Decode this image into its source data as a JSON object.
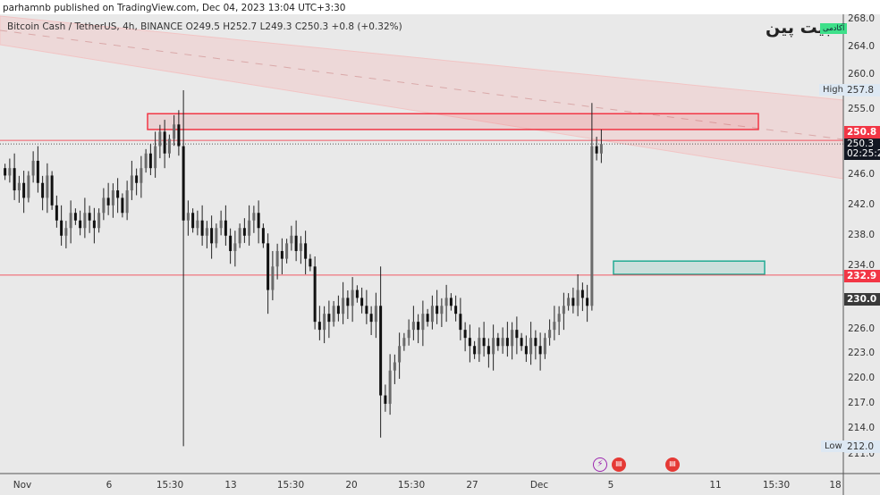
{
  "published": "parhamnb published on TradingView.com, Dec 04, 2023 13:04 UTC+3:30",
  "legend": "Bitcoin Cash / TetherUS, 4h, BINANCE  O249.5  H252.7  L249.3  C250.3  +0.8 (+0.32%)",
  "logo": {
    "text": "بیت پین",
    "badge": "آکادمی"
  },
  "chart_data": {
    "type": "candlestick",
    "symbol": "Bitcoin Cash / TetherUS",
    "interval": "4h",
    "exchange": "BINANCE",
    "y_scale": "log",
    "ylim": [
      211,
      268
    ],
    "y_ticks": [
      "268.0",
      "264.0",
      "260.0",
      "255.0",
      "246.0",
      "242.0",
      "238.0",
      "234.0",
      "226.0",
      "223.0",
      "220.0",
      "217.0",
      "214.0",
      "211.0"
    ],
    "x_ticks": [
      "Nov",
      "6",
      "15:30",
      "13",
      "15:30",
      "20",
      "15:30",
      "27",
      "Dec",
      "5",
      "11",
      "15:30",
      "18"
    ],
    "closes": [
      246,
      247,
      244,
      245,
      243,
      246,
      248,
      245,
      243,
      246,
      242,
      240,
      238,
      239,
      241,
      240,
      239,
      241,
      240,
      239,
      241,
      243,
      242,
      244,
      243,
      241,
      244,
      246,
      245,
      247,
      249,
      247,
      250,
      252,
      249,
      251,
      253,
      250,
      240,
      241,
      239,
      240,
      238,
      239,
      237,
      239,
      240,
      238,
      236,
      237,
      239,
      238,
      240,
      241,
      239,
      237,
      231,
      234,
      236,
      235,
      237,
      238,
      236,
      237,
      235,
      234,
      227,
      226,
      228,
      227,
      229,
      228,
      230,
      229,
      231,
      230,
      229,
      228,
      227,
      229,
      218,
      217,
      221,
      222,
      224,
      225,
      226,
      227,
      226,
      228,
      227,
      229,
      228,
      229,
      230,
      229,
      228,
      226,
      225,
      224,
      223,
      225,
      224,
      223,
      225,
      224,
      225,
      224,
      226,
      225,
      224,
      223,
      225,
      224,
      223,
      225,
      226,
      227,
      228,
      229,
      230,
      229,
      231,
      230,
      229,
      250,
      249,
      250.3
    ],
    "wick_overrides": [
      {
        "index": 38,
        "high": 257.8,
        "low": 212
      },
      {
        "index": 80,
        "high": 234,
        "low": 213
      },
      {
        "index": 56,
        "low": 228
      },
      {
        "index": 125,
        "high": 256
      }
    ],
    "high_marker": {
      "label": "High",
      "value": "257.8"
    },
    "low_marker": {
      "label": "Low",
      "value": "212.0"
    },
    "price_labels": [
      {
        "value": "250.8",
        "color": "#f23645"
      },
      {
        "value": "250.3",
        "sub": "02:25:2",
        "color": "#131722"
      },
      {
        "value": "232.9",
        "color": "#f23645"
      },
      {
        "value": "230.0",
        "color": "#3a3a3a"
      }
    ],
    "drawings": {
      "resistance_zone": [
        252.3,
        254.5
      ],
      "support_zone": [
        233.0,
        234.7
      ],
      "horizontal_lines": [
        250.8,
        232.9
      ],
      "colors": {
        "red": "#f23645",
        "teal": "#22ab94",
        "channel": "#f2c4c4"
      }
    }
  },
  "events": [
    {
      "icon": "lightning-icon",
      "color": "#9c27b0"
    },
    {
      "icon": "us-flag-icon"
    },
    {
      "icon": "us-flag-icon"
    }
  ]
}
